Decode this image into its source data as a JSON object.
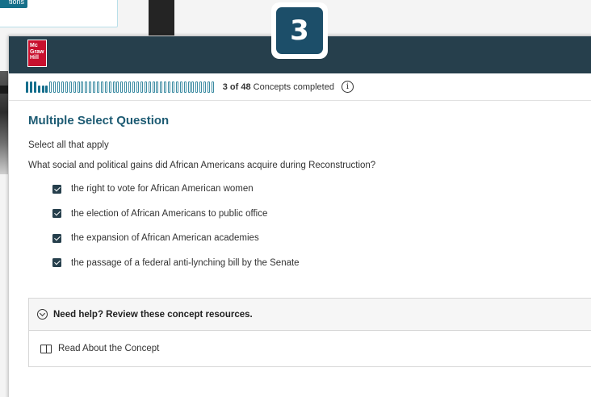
{
  "background": {
    "card_button_label": "tions"
  },
  "step_badge": "3",
  "brand": {
    "logo_lines": [
      "Mc",
      "Graw",
      "Hill"
    ]
  },
  "progress": {
    "completed": 3,
    "total": 48,
    "count_label": "3 of 48",
    "suffix": "Concepts completed",
    "info_icon": "info-icon"
  },
  "question": {
    "type": "Multiple Select Question",
    "instruction": "Select all that apply",
    "prompt": "What social and political gains did African Americans acquire during Reconstruction?",
    "options": [
      {
        "label": "the right to vote for African American women",
        "checked": true
      },
      {
        "label": "the election of African Americans to public office",
        "checked": true
      },
      {
        "label": "the expansion of African American academies",
        "checked": true
      },
      {
        "label": "the passage of a federal anti-lynching bill by the Senate",
        "checked": true
      }
    ]
  },
  "help": {
    "heading": "Need help? Review these concept resources.",
    "items": [
      {
        "label": "Read About the Concept",
        "icon": "book-icon"
      }
    ]
  },
  "colors": {
    "header_bg": "#263f4c",
    "accent": "#1d5b73",
    "progress": "#166f8d",
    "brand_red": "#c8102e"
  }
}
